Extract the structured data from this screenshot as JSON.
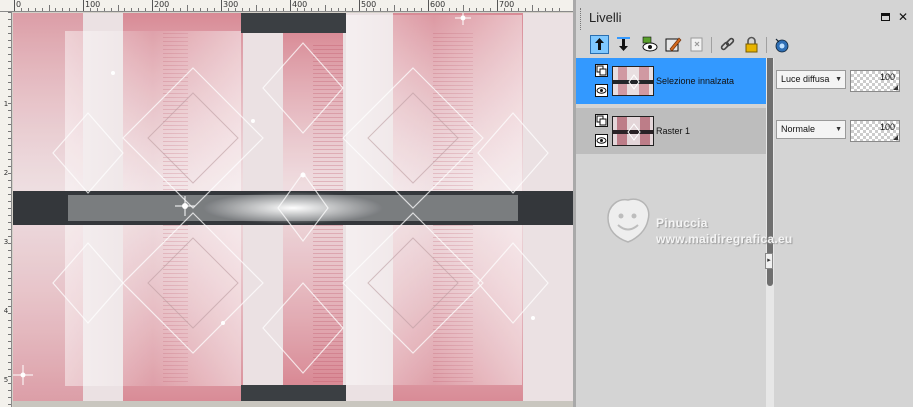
{
  "ruler": {
    "top_labels": [
      "0",
      "100",
      "200",
      "300",
      "400",
      "500",
      "600",
      "700"
    ],
    "left_labels": [
      "1",
      "2",
      "3",
      "4",
      "5"
    ]
  },
  "layers_panel": {
    "title": "Livelli",
    "toolbar_icons": [
      "move-layer-up-icon",
      "move-layer-down-icon",
      "visibility-toggle-icon",
      "layer-properties-icon",
      "delete-layer-icon",
      "link-layers-icon",
      "lock-layer-icon",
      "mask-icon"
    ],
    "layers": [
      {
        "name": "Selezione innalzata",
        "blend_mode": "Luce diffusa",
        "opacity": "100",
        "selected": true
      },
      {
        "name": "Raster 1",
        "blend_mode": "Normale",
        "opacity": "100",
        "selected": false
      }
    ]
  },
  "watermark": {
    "name": "Pinuccia",
    "url": "www.maidiregrafica.eu"
  },
  "colors": {
    "selected_row": "#3399ff",
    "panel_bg": "#d4d4d4",
    "image_accent_pink": "#c94a5c",
    "image_dark_band": "#23272b"
  }
}
